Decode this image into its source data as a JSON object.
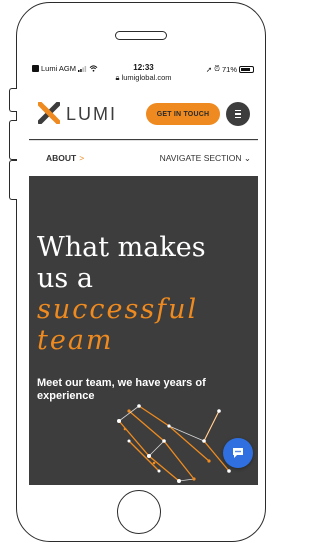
{
  "statusbar": {
    "carrier": "Lumi AGM",
    "time": "12:33",
    "url": "lumiglobal.com",
    "battery": "71%"
  },
  "header": {
    "logo_text": "LUMI",
    "cta_label": "GET IN TOUCH",
    "menu_icon": "menu-icon"
  },
  "navbar": {
    "about_label": "ABOUT",
    "about_chevron": ">",
    "section_label": "NAVIGATE SECTION",
    "section_chevron": "⌄"
  },
  "hero": {
    "line1": "What makes",
    "line2": "us a",
    "accent1": "successful",
    "accent2": "team",
    "subtitle": "Meet our team, we have years of experience"
  },
  "colors": {
    "accent": "#ee8a1f",
    "dark": "#3c3d3c",
    "chat": "#2f6fe0"
  },
  "icons": {
    "chat": "chat-bubble-icon",
    "lock": "lock-icon",
    "wifi": "wifi-icon",
    "signal": "signal-icon",
    "battery": "battery-icon"
  }
}
